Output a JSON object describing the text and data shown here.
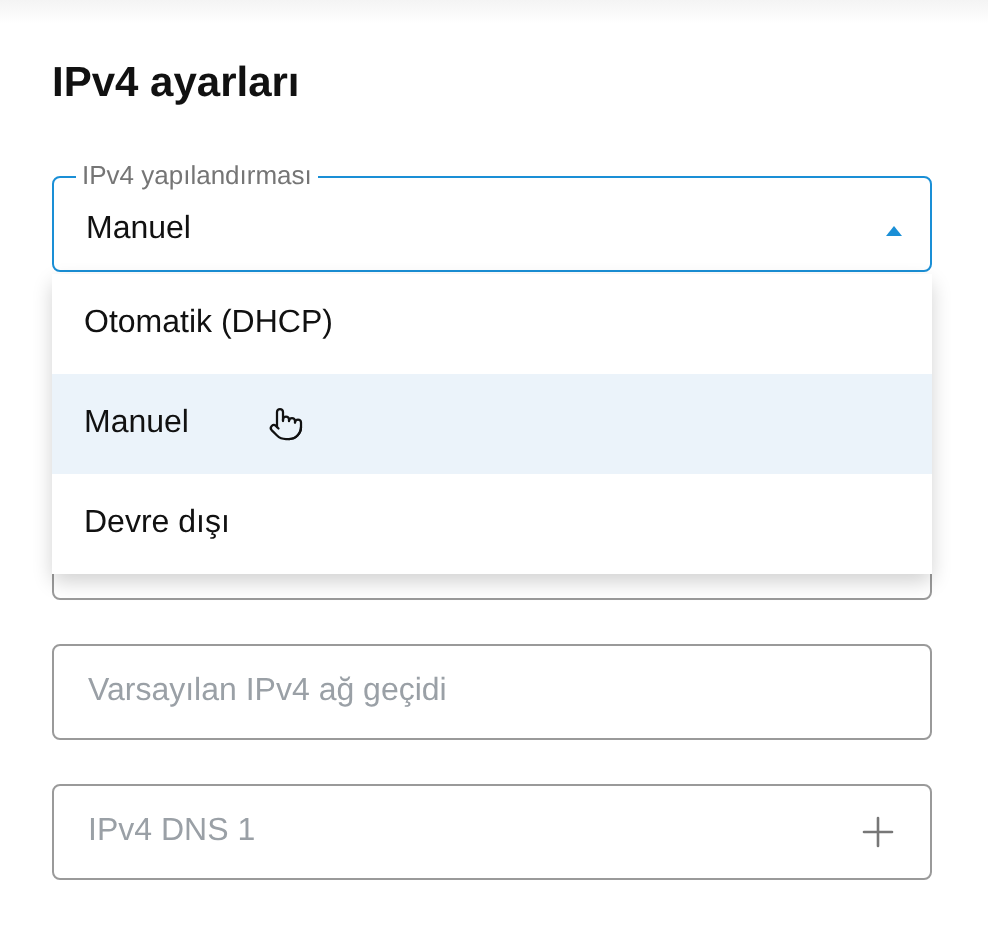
{
  "title": "IPv4 ayarları",
  "config": {
    "label": "IPv4 yapılandırması",
    "value": "Manuel",
    "expanded": true
  },
  "options": [
    {
      "label": "Otomatik (DHCP)",
      "selected": false
    },
    {
      "label": "Manuel",
      "selected": true
    },
    {
      "label": "Devre dışı",
      "selected": false
    }
  ],
  "fields": [
    {
      "kind": "blank"
    },
    {
      "kind": "text",
      "placeholder": "Varsayılan IPv4 ağ geçidi"
    },
    {
      "kind": "add",
      "placeholder": "IPv4 DNS 1"
    }
  ]
}
